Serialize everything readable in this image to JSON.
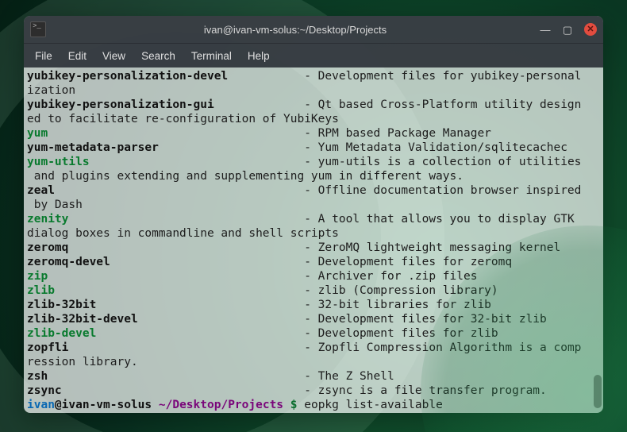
{
  "window": {
    "title": "ivan@ivan-vm-solus:~/Desktop/Projects"
  },
  "menubar": [
    "File",
    "Edit",
    "View",
    "Search",
    "Terminal",
    "Help"
  ],
  "packages": [
    {
      "name": "yubikey-personalization-devel",
      "style": "bold",
      "desc": "Development files for yubikey-personalization"
    },
    {
      "name": "yubikey-personalization-gui",
      "style": "bold",
      "desc": "Qt based Cross-Platform utility designed to facilitate re-configuration of YubiKeys"
    },
    {
      "name": "yum",
      "style": "green",
      "desc": "RPM based Package Manager"
    },
    {
      "name": "yum-metadata-parser",
      "style": "bold",
      "desc": "Yum Metadata Validation/sqlitecachec"
    },
    {
      "name": "yum-utils",
      "style": "green",
      "desc": "yum-utils is a collection of utilities and plugins extending and supplementing yum in different ways."
    },
    {
      "name": "zeal",
      "style": "bold",
      "desc": "Offline documentation browser inspired by Dash"
    },
    {
      "name": "zenity",
      "style": "green",
      "desc": "A tool that allows you to display GTK dialog boxes in commandline and shell scripts"
    },
    {
      "name": "zeromq",
      "style": "bold",
      "desc": "ZeroMQ lightweight messaging kernel"
    },
    {
      "name": "zeromq-devel",
      "style": "bold",
      "desc": "Development files for zeromq"
    },
    {
      "name": "zip",
      "style": "green",
      "desc": "Archiver for .zip files"
    },
    {
      "name": "zlib",
      "style": "green",
      "desc": "zlib (Compression library)"
    },
    {
      "name": "zlib-32bit",
      "style": "bold",
      "desc": "32-bit libraries for zlib"
    },
    {
      "name": "zlib-32bit-devel",
      "style": "bold",
      "desc": "Development files for 32-bit zlib"
    },
    {
      "name": "zlib-devel",
      "style": "green",
      "desc": "Development files for zlib"
    },
    {
      "name": "zopfli",
      "style": "bold",
      "desc": "Zopfli Compression Algorithm is a compression library."
    },
    {
      "name": "zsh",
      "style": "bold",
      "desc": "The Z Shell"
    },
    {
      "name": "zsync",
      "style": "bold",
      "desc": "zsync is a file transfer program."
    }
  ],
  "prompt": {
    "user": "ivan",
    "at": "@",
    "host": "ivan-vm-solus",
    "path": "~/Desktop/Projects",
    "symbol": "$",
    "command": "eopkg list-available"
  },
  "layout": {
    "name_col_width": 40
  }
}
